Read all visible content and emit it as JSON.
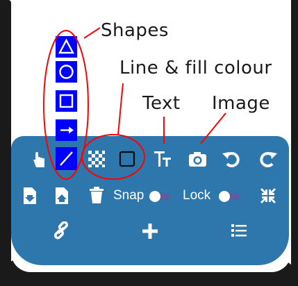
{
  "annotations": {
    "shapes": "Shapes",
    "line_fill": "Line & fill colour",
    "text": "Text",
    "image": "Image"
  },
  "shape_buttons": [
    "triangle-icon",
    "circle-icon",
    "square-icon",
    "arrow-icon",
    "line-icon"
  ],
  "toolbar": {
    "row1": [
      "pointer-hand-icon",
      "line-tool-icon",
      "fill-pattern-icon",
      "line-colour-icon",
      "text-size-icon",
      "camera-icon",
      "undo-icon",
      "redo-icon"
    ],
    "row2": {
      "icons": [
        "download-file-icon",
        "upload-file-icon",
        "trash-icon",
        "shrink-icon"
      ],
      "snap_label": "Snap",
      "lock_label": "Lock"
    },
    "row3": [
      "link-icon",
      "plus-icon",
      "list-icon"
    ]
  },
  "colors": {
    "panel": "#2e77ad",
    "shape_button": "#0000ff",
    "annotation_ring": "#ff0000",
    "toggle_track": "#5f5aa2"
  }
}
